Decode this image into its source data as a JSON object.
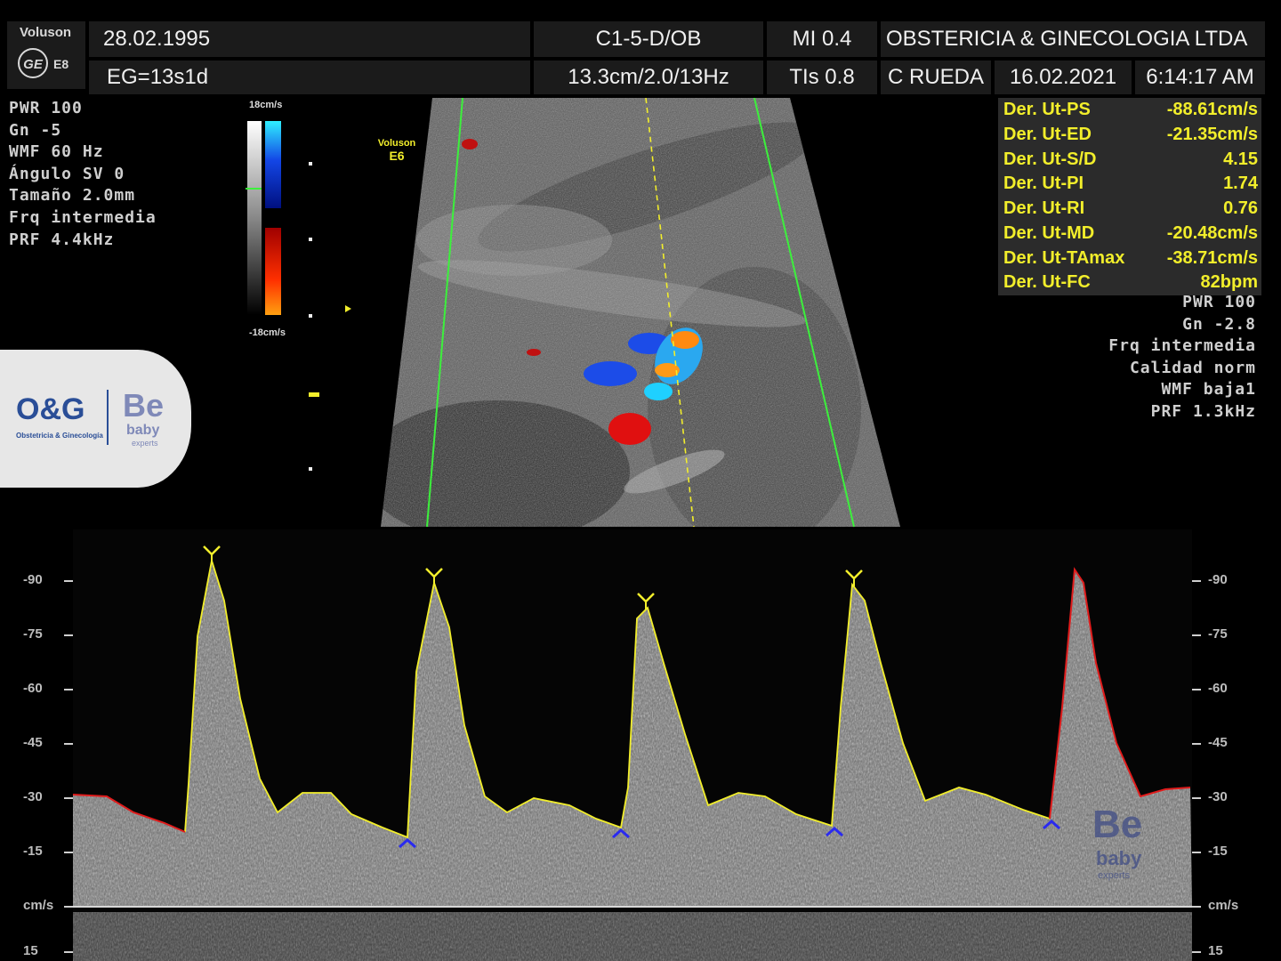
{
  "header": {
    "brand": "Voluson",
    "brand_logo": "GE",
    "model": "E8",
    "patient_dob": "28.02.1995",
    "gestational_age": "EG=13s1d",
    "probe": "C1-5-D/OB",
    "depth_info": "13.3cm/2.0/13Hz",
    "mi": "MI 0.4",
    "tis": "TIs 0.8",
    "institution": "OBSTERICIA & GINECOLOGIA LTDA",
    "operator": "C RUEDA",
    "date": "16.02.2021",
    "time": "6:14:17 AM"
  },
  "left_params": [
    "PWR 100",
    "Gn  -5",
    "WMF 60 Hz",
    "Ángulo SV  0",
    "Tamaño  2.0mm",
    "Frq intermedia",
    "PRF  4.4kHz"
  ],
  "color_scale": {
    "top": "18cm/s",
    "bottom": "-18cm/s"
  },
  "image_label": {
    "brand": "Voluson",
    "model": "E6"
  },
  "measurements": [
    {
      "label": "Der. Ut-PS",
      "value": "-88.61cm/s"
    },
    {
      "label": "Der. Ut-ED",
      "value": "-21.35cm/s"
    },
    {
      "label": "Der. Ut-S/D",
      "value": "4.15"
    },
    {
      "label": "Der. Ut-PI",
      "value": "1.74"
    },
    {
      "label": "Der. Ut-RI",
      "value": "0.76"
    },
    {
      "label": "Der. Ut-MD",
      "value": "-20.48cm/s"
    },
    {
      "label": "Der. Ut-TAmax",
      "value": "-38.71cm/s"
    },
    {
      "label": "Der. Ut-FC",
      "value": "82bpm"
    }
  ],
  "right_params": [
    "PWR 100",
    "Gn -2.8",
    "Frq intermedia",
    "Calidad norm",
    "WMF baja1",
    "PRF  1.3kHz"
  ],
  "logo": {
    "og": "O&G",
    "og_sub": "Obstetricia & Ginecología",
    "be": "Be",
    "baby": "baby",
    "experts": "experts"
  },
  "doppler": {
    "unit": "cm/s",
    "ticks": [
      "-90",
      "-75",
      "-60",
      "-45",
      "-30",
      "-15",
      "cm/s",
      "15"
    ],
    "colors": {
      "trace": "#f2ee2b",
      "trace_end": "#e01b1b",
      "marker_low": "#2a2af0",
      "baseline": "#d8d8d8"
    }
  }
}
